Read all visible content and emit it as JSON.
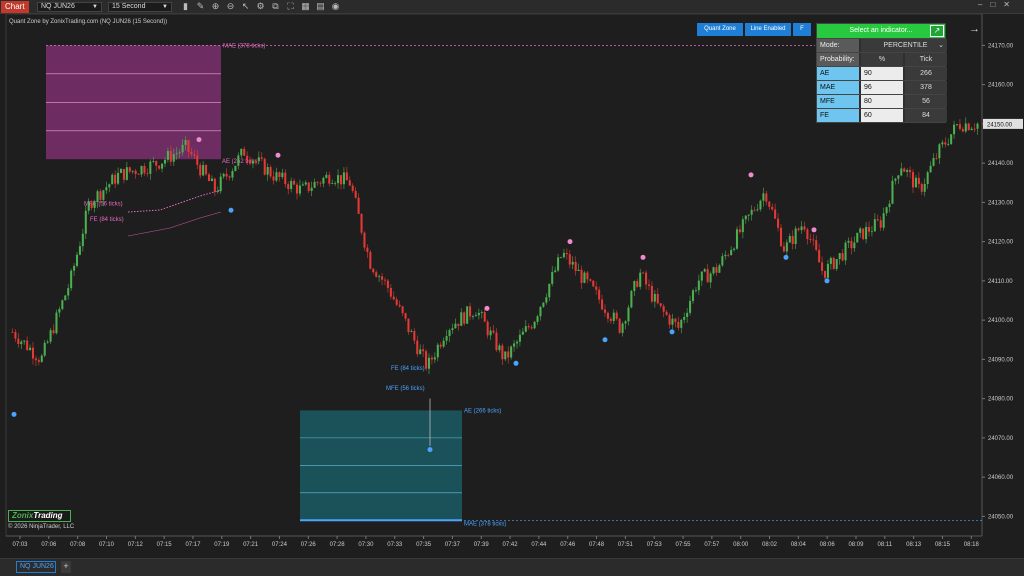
{
  "toolbar": {
    "app_tab": "Chart",
    "instrument": "NQ JUN26",
    "interval": "15 Second"
  },
  "chart_title": "Quant Zone by ZonixTrading.com (NQ JUN26 (15 Second))",
  "quant_buttons": [
    "Quant Zone",
    "Line Enabled",
    "F"
  ],
  "panel": {
    "header": "Select an indicator...",
    "mode_label": "Mode:",
    "mode_value": "PERCENTILE",
    "prob_label": "Probability:",
    "pct_header": "%",
    "tick_header": "Tick",
    "rows": [
      {
        "name": "AE",
        "pct": "90",
        "tick": "266"
      },
      {
        "name": "MAE",
        "pct": "96",
        "tick": "378"
      },
      {
        "name": "MFE",
        "pct": "80",
        "tick": "56"
      },
      {
        "name": "FE",
        "pct": "60",
        "tick": "84"
      }
    ]
  },
  "colors": {
    "up": "#4caf50",
    "down": "#e53935",
    "pink": "#e86cc4",
    "blue": "#4aa3ff"
  },
  "chart_data": {
    "type": "candlestick",
    "y_ticks": [
      24170,
      24160,
      24150,
      24140,
      24130,
      24120,
      24110,
      24100,
      24090,
      24080,
      24070,
      24060,
      24050
    ],
    "y_tick_labels": [
      "24170.00",
      "24160.00",
      "24150.00",
      "24140.00",
      "24130.00",
      "24120.00",
      "24110.00",
      "24100.00",
      "24090.00",
      "24080.00",
      "24070.00",
      "24060.00",
      "24050.00"
    ],
    "ylim": [
      24045,
      24178
    ],
    "current_price": "24150.00",
    "x_labels": [
      "07:03",
      "07:06",
      "07:08",
      "07:10",
      "07:12",
      "07:15",
      "07:17",
      "07:19",
      "07:21",
      "07:24",
      "07:26",
      "07:28",
      "07:30",
      "07:33",
      "07:35",
      "07:37",
      "07:39",
      "07:42",
      "07:44",
      "07:46",
      "07:48",
      "07:51",
      "07:53",
      "07:55",
      "07:57",
      "08:00",
      "08:02",
      "08:04",
      "08:06",
      "08:09",
      "08:11",
      "08:13",
      "08:15",
      "08:18"
    ],
    "path_points": [
      [
        0,
        24097
      ],
      [
        0.03,
        24090
      ],
      [
        0.06,
        24110
      ],
      [
        0.08,
        24130
      ],
      [
        0.11,
        24137
      ],
      [
        0.15,
        24140
      ],
      [
        0.18,
        24144
      ],
      [
        0.21,
        24133
      ],
      [
        0.24,
        24143
      ],
      [
        0.27,
        24137
      ],
      [
        0.3,
        24133
      ],
      [
        0.33,
        24137
      ],
      [
        0.35,
        24135
      ],
      [
        0.37,
        24115
      ],
      [
        0.39,
        24108
      ],
      [
        0.41,
        24098
      ],
      [
        0.43,
        24088
      ],
      [
        0.45,
        24098
      ],
      [
        0.48,
        24103
      ],
      [
        0.51,
        24090
      ],
      [
        0.54,
        24100
      ],
      [
        0.57,
        24117
      ],
      [
        0.6,
        24108
      ],
      [
        0.63,
        24098
      ],
      [
        0.65,
        24112
      ],
      [
        0.67,
        24103
      ],
      [
        0.69,
        24098
      ],
      [
        0.71,
        24110
      ],
      [
        0.73,
        24113
      ],
      [
        0.76,
        24125
      ],
      [
        0.78,
        24133
      ],
      [
        0.8,
        24118
      ],
      [
        0.82,
        24125
      ],
      [
        0.84,
        24112
      ],
      [
        0.86,
        24117
      ],
      [
        0.88,
        24122
      ],
      [
        0.9,
        24125
      ],
      [
        0.92,
        24140
      ],
      [
        0.94,
        24133
      ],
      [
        0.96,
        24143
      ],
      [
        0.98,
        24150
      ],
      [
        1,
        24150
      ]
    ],
    "annotations": {
      "upper_zone": [
        "MAE (378 ticks)",
        "AE (252 ticks)",
        "MFE (56 ticks)",
        "FE (84 ticks)"
      ],
      "lower_zone": [
        "FE (84 ticks)",
        "MFE (56 ticks)",
        "AE (266 ticks)",
        "MAE (378 ticks)"
      ]
    }
  },
  "logo": {
    "brand_zonix": "Zonix",
    "brand_trading": "Trading"
  },
  "copyright": "© 2026 NinjaTrader, LLC",
  "tabs": {
    "instrument_tab": "NQ JUN26",
    "add_tab": "+"
  }
}
